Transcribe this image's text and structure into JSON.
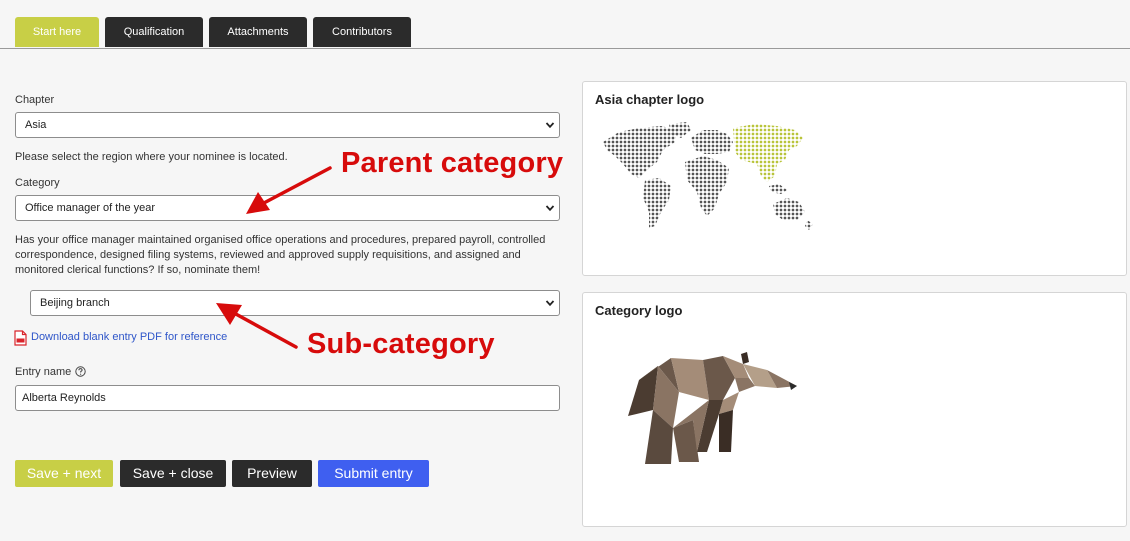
{
  "tabs": [
    {
      "label": "Start here",
      "active": true
    },
    {
      "label": "Qualification",
      "active": false
    },
    {
      "label": "Attachments",
      "active": false
    },
    {
      "label": "Contributors",
      "active": false
    }
  ],
  "form": {
    "chapter_label": "Chapter",
    "chapter_value": "Asia",
    "chapter_help": "Please select the region where your nominee is located.",
    "category_label": "Category",
    "category_value": "Office manager of the year",
    "category_help_1": "Has your office manager maintained organised office operations and procedures, prepared payroll, controlled",
    "category_help_2": "correspondence, designed filing systems, reviewed and approved supply requisitions, and assigned and",
    "category_help_3": "monitored clerical functions? If so, nominate them!",
    "subcategory_value": "Beijing branch",
    "download_link": "Download blank entry PDF for reference",
    "entry_name_label": "Entry name",
    "entry_name_value": "Alberta Reynolds"
  },
  "buttons": {
    "save_next": "Save + next",
    "save_close": "Save + close",
    "preview": "Preview",
    "submit": "Submit entry"
  },
  "panels": {
    "chapter_logo_title": "Asia chapter logo",
    "category_logo_title": "Category logo"
  },
  "annotations": {
    "parent": "Parent category",
    "sub": "Sub-category"
  },
  "colors": {
    "accent": "#c8cf46",
    "dark": "#2b2b2b",
    "submit": "#3f5ff0",
    "annotation": "#d70b0b"
  }
}
